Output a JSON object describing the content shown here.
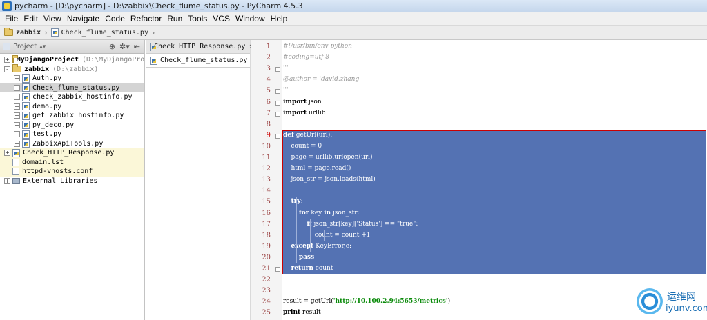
{
  "window": {
    "title": "pycharm - [D:\\pycharm] - D:\\zabbix\\Check_flume_status.py - PyCharm 4.5.3"
  },
  "menu": [
    "File",
    "Edit",
    "View",
    "Navigate",
    "Code",
    "Refactor",
    "Run",
    "Tools",
    "VCS",
    "Window",
    "Help"
  ],
  "breadcrumb": {
    "folder": "zabbix",
    "file": "Check_flume_status.py"
  },
  "project_panel": {
    "header": "Project",
    "tree": [
      {
        "label": "MyDjangoProject",
        "hint": "(D:\\MyDjangoPro_",
        "level": 0,
        "expander": "+",
        "icon": "folder",
        "bold": true
      },
      {
        "label": "zabbix",
        "hint": "(D:\\zabbix)",
        "level": 0,
        "expander": "-",
        "icon": "folder",
        "bold": true
      },
      {
        "label": "Auth.py",
        "level": 1,
        "expander": "+",
        "icon": "python"
      },
      {
        "label": "Check_flume_status.py",
        "level": 1,
        "expander": "+",
        "icon": "python",
        "selected": true
      },
      {
        "label": "check_zabbix_hostinfo.py",
        "level": 1,
        "expander": "+",
        "icon": "python"
      },
      {
        "label": "demo.py",
        "level": 1,
        "expander": "+",
        "icon": "python"
      },
      {
        "label": "get_zabbix_hostinfo.py",
        "level": 1,
        "expander": "+",
        "icon": "python"
      },
      {
        "label": "py_deco.py",
        "level": 1,
        "expander": "+",
        "icon": "python"
      },
      {
        "label": "test.py",
        "level": 1,
        "expander": "+",
        "icon": "python"
      },
      {
        "label": "ZabbixApiTools.py",
        "level": 1,
        "expander": "+",
        "icon": "python"
      },
      {
        "label": "Check_HTTP_Response.py",
        "level": 0,
        "expander": "+",
        "icon": "python",
        "highlight": true
      },
      {
        "label": "domain.lst",
        "level": 0,
        "icon": "file",
        "highlight": true
      },
      {
        "label": "httpd-vhosts.conf",
        "level": 0,
        "icon": "file",
        "highlight": true
      },
      {
        "label": "External Libraries",
        "level": 0,
        "expander": "+",
        "icon": "library"
      }
    ]
  },
  "tabs": [
    {
      "label": "Check_HTTP_Response.py",
      "close": "×"
    },
    {
      "label": "Check_flume_status.py",
      "close": ""
    }
  ],
  "code": [
    {
      "n": "1",
      "text": "#!/usr/bin/env python",
      "style": "comment"
    },
    {
      "n": "2",
      "text": "#coding=utf-8",
      "style": "comment"
    },
    {
      "n": "3",
      "text": "'''",
      "style": "comment"
    },
    {
      "n": "4",
      "text": "@author = 'david.zhang'",
      "style": "comment"
    },
    {
      "n": "5",
      "text": "'''",
      "style": "comment"
    },
    {
      "n": "6",
      "kw": "import",
      "text": " json"
    },
    {
      "n": "7",
      "kw": "import",
      "text": " urllib"
    },
    {
      "n": "8",
      "text": ""
    },
    {
      "n": "9",
      "kw": "def",
      "text": " getUrl(url):",
      "sel": true
    },
    {
      "n": "10",
      "text": "    count = 0",
      "sel": true
    },
    {
      "n": "11",
      "text": "    page = urllib.urlopen(url)",
      "sel": true
    },
    {
      "n": "12",
      "text": "    html = page.read()",
      "sel": true
    },
    {
      "n": "13",
      "text": "    json_str = json.loads(html)",
      "sel": true
    },
    {
      "n": "14",
      "text": "",
      "sel": true
    },
    {
      "n": "15",
      "pre": "    ",
      "kw": "try",
      "text": ":",
      "sel": true
    },
    {
      "n": "16",
      "pre": "        ",
      "kw": "for",
      "text": " key ",
      "kw2": "in",
      "text2": " json_str:",
      "sel": true
    },
    {
      "n": "17",
      "pre": "            ",
      "kw": "if",
      "text": " json_str[key]['Status'] == \"true\":",
      "sel": true
    },
    {
      "n": "18",
      "text": "                count = count +1",
      "sel": true
    },
    {
      "n": "19",
      "pre": "    ",
      "kw": "except",
      "text": " KeyError,e:",
      "sel": true
    },
    {
      "n": "20",
      "pre": "        ",
      "kw": "pass",
      "text": "",
      "sel": true
    },
    {
      "n": "21",
      "pre": "    ",
      "kw": "return",
      "text": " count",
      "sel": true
    },
    {
      "n": "22",
      "text": ""
    },
    {
      "n": "23",
      "text": ""
    },
    {
      "n": "24",
      "text": "result = getUrl(",
      "str": "'http://10.100.2.94:5653/metrics'",
      "text2": ")"
    },
    {
      "n": "25",
      "kw": "print",
      "text": " result"
    }
  ],
  "watermark": {
    "cn": "运维网",
    "en": "iyunv.com"
  }
}
